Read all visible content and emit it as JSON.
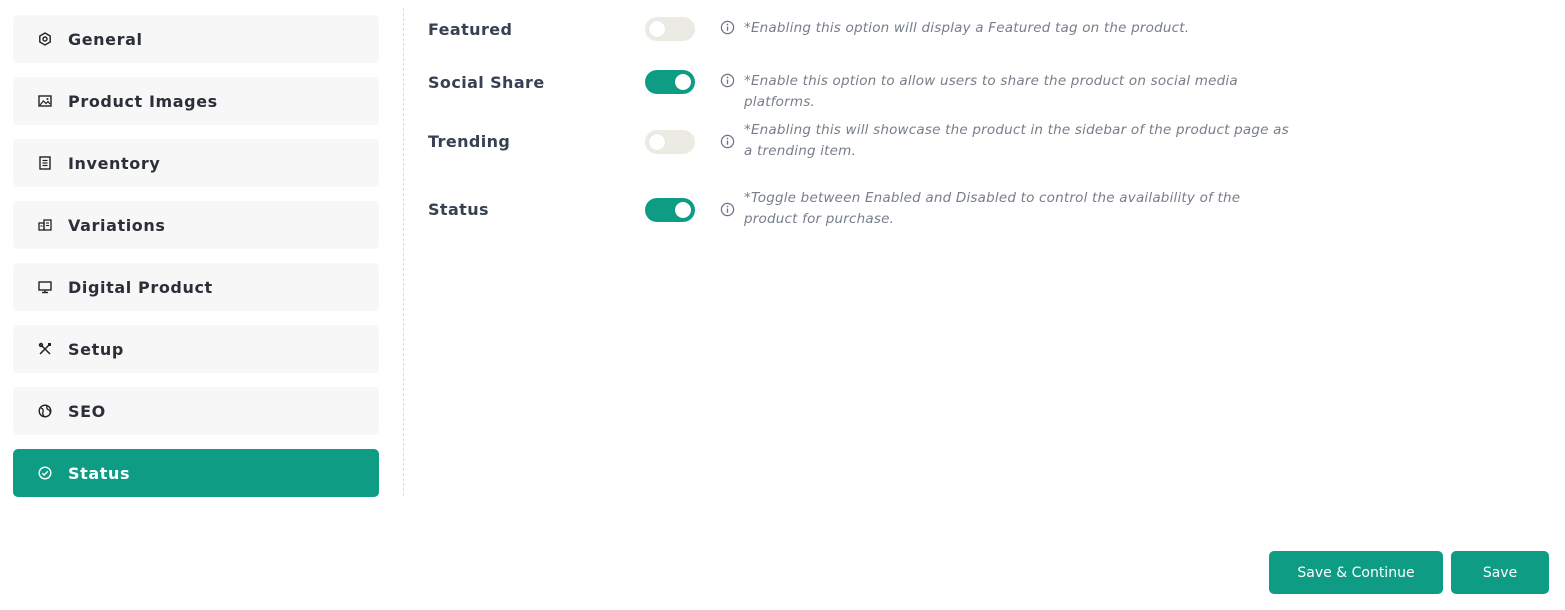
{
  "sidebar": {
    "items": [
      {
        "label": "General",
        "icon": "gear-hexagon-icon"
      },
      {
        "label": "Product Images",
        "icon": "image-icon"
      },
      {
        "label": "Inventory",
        "icon": "document-list-icon"
      },
      {
        "label": "Variations",
        "icon": "variations-icon"
      },
      {
        "label": "Digital Product",
        "icon": "monitor-icon"
      },
      {
        "label": "Setup",
        "icon": "tools-icon"
      },
      {
        "label": "SEO",
        "icon": "globe-icon"
      },
      {
        "label": "Status",
        "icon": "check-circle-icon",
        "active": true
      }
    ]
  },
  "settings": [
    {
      "title": "Featured",
      "enabled": false,
      "help": "*Enabling this option will display a Featured tag on the product."
    },
    {
      "title": "Social Share",
      "enabled": true,
      "help": "*Enable this option to allow users to share the product on social media platforms."
    },
    {
      "title": "Trending",
      "enabled": false,
      "help": "*Enabling this will showcase the product in the sidebar of the product page as a trending item."
    },
    {
      "title": "Status",
      "enabled": true,
      "help": "*Toggle between Enabled and Disabled to control the availability of the product for purchase."
    }
  ],
  "actions": {
    "save_continue_label": "Save & Continue",
    "save_label": "Save"
  },
  "colors": {
    "accent": "#0e9c84",
    "toggle_off": "#ebebe3",
    "nav_bg": "#f7f7f7"
  }
}
